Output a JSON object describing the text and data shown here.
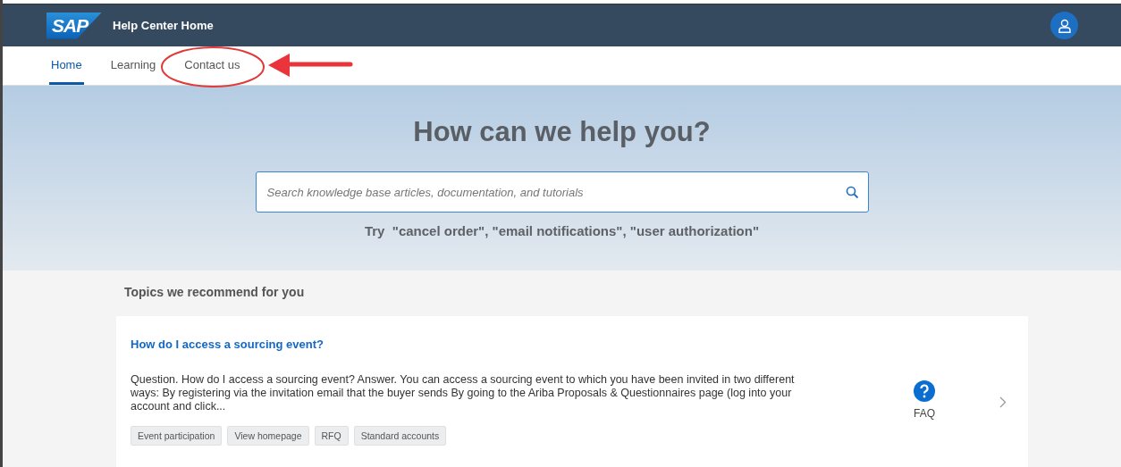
{
  "header": {
    "logo": "SAP",
    "title": "Help Center Home"
  },
  "tabs": [
    {
      "label": "Home",
      "selected": true
    },
    {
      "label": "Learning",
      "selected": false
    },
    {
      "label": "Contact us",
      "selected": false,
      "annotated": true
    }
  ],
  "hero": {
    "title": "How can we help you?",
    "search": {
      "placeholder": "Search knowledge base articles, documentation, and tutorials"
    },
    "suggestion": "Try  \"cancel order\", \"email notifications\", \"user authorization\""
  },
  "section": {
    "title": "Topics we recommend for you"
  },
  "cards": [
    {
      "title": "How do I access a sourcing event?",
      "body": "Question. How do I access a sourcing event? Answer. You can access a sourcing event to which you have been invited in two different ways: By registering via the invitation email that the buyer sends By going to the Ariba Proposals & Questionnaires page (log into your account and click...",
      "type": "FAQ",
      "tags": [
        "Event participation",
        "View homepage",
        "RFQ",
        "Standard accounts"
      ]
    }
  ]
}
